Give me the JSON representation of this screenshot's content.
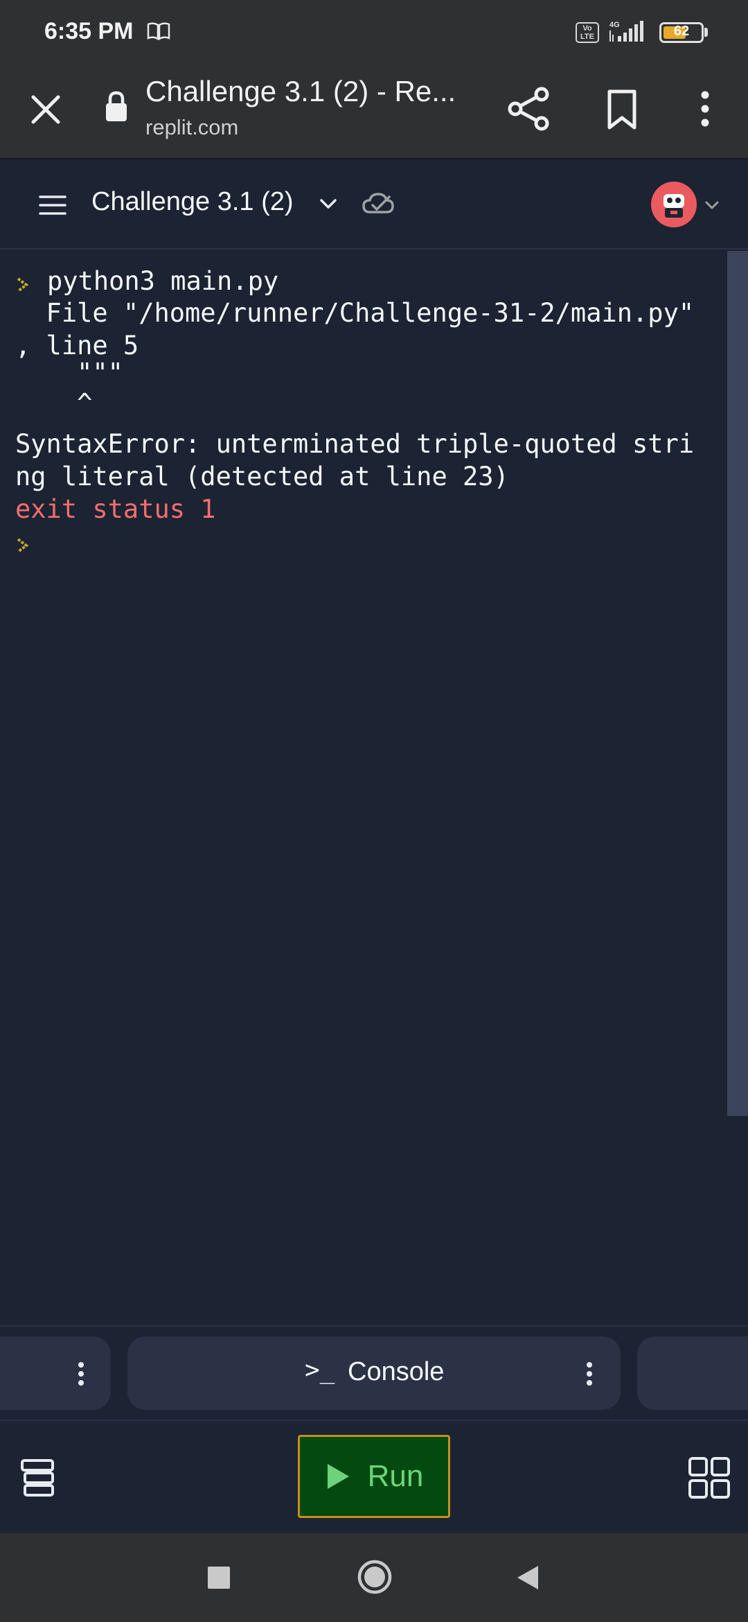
{
  "status_bar": {
    "time": "6:35 PM",
    "volte": "Vo\nLTE",
    "network": "4G",
    "battery_level": "62",
    "battery_fraction": 0.62,
    "icons": [
      "book-icon",
      "volte-icon",
      "signal-icon",
      "battery-icon"
    ]
  },
  "browser": {
    "title": "Challenge 3.1 (2) - Re...",
    "url": "replit.com",
    "icons": [
      "close-icon",
      "lock-icon",
      "share-icon",
      "bookmark-icon",
      "more-vertical-icon"
    ]
  },
  "repl_header": {
    "name": "Challenge 3.1 (2)",
    "icons": [
      "hamburger-menu-icon",
      "chevron-down-icon",
      "cloud-check-icon",
      "avatar-icon"
    ]
  },
  "console": {
    "lines": [
      {
        "text": "python3 main.py",
        "kind": "command"
      },
      {
        "text": "  File \"/home/runner/Challenge-31-2/main.py\"",
        "kind": "output"
      },
      {
        "text": ", line 5",
        "kind": "output"
      },
      {
        "text": "    \"\"\"",
        "kind": "output"
      },
      {
        "text": "    ^",
        "kind": "output"
      },
      {
        "text": "SyntaxError: unterminated triple-quoted stri",
        "kind": "output"
      },
      {
        "text": "ng literal (detected at line 23)",
        "kind": "output"
      },
      {
        "text": "exit status 1",
        "kind": "error"
      }
    ]
  },
  "tabs": {
    "active_icon": ">_",
    "active_label": "Console"
  },
  "toolbar": {
    "run_label": "Run"
  },
  "colors": {
    "background": "#1c2333",
    "surface": "#2b3245",
    "text": "#f5f9fc",
    "error": "#f26f6f",
    "prompt": "#c4a62a",
    "run_bg": "#044a10",
    "run_border": "#c78f1b",
    "run_text": "#6ed27c",
    "avatar": "#ea5b5f"
  }
}
